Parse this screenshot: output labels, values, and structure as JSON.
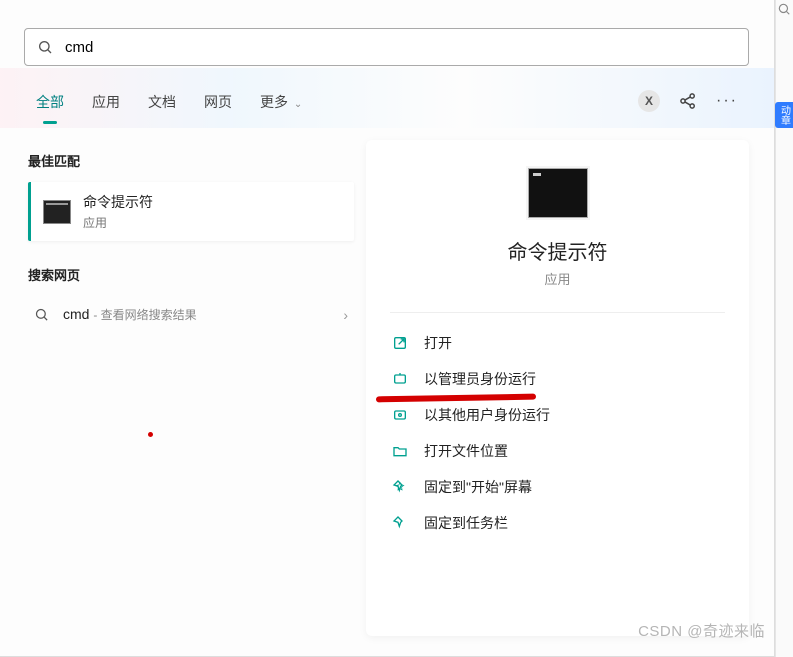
{
  "search": {
    "value": "cmd"
  },
  "tabs": {
    "items": [
      "全部",
      "应用",
      "文档",
      "网页",
      "更多"
    ],
    "active_index": 0
  },
  "top_actions": {
    "avatar_initial": "X"
  },
  "left": {
    "best_match_label": "最佳匹配",
    "result": {
      "title": "命令提示符",
      "subtitle": "应用"
    },
    "web_label": "搜索网页",
    "web_item": {
      "name": "cmd",
      "desc": "- 查看网络搜索结果"
    }
  },
  "right": {
    "title": "命令提示符",
    "kind": "应用",
    "actions": [
      {
        "icon": "open",
        "label": "打开"
      },
      {
        "icon": "admin",
        "label": "以管理员身份运行"
      },
      {
        "icon": "other-user",
        "label": "以其他用户身份运行"
      },
      {
        "icon": "folder",
        "label": "打开文件位置"
      },
      {
        "icon": "pin",
        "label": "固定到\"开始\"屏幕"
      },
      {
        "icon": "pin",
        "label": "固定到任务栏"
      }
    ]
  },
  "side": {
    "badge": "动章"
  },
  "watermark": "CSDN @奇迹来临"
}
